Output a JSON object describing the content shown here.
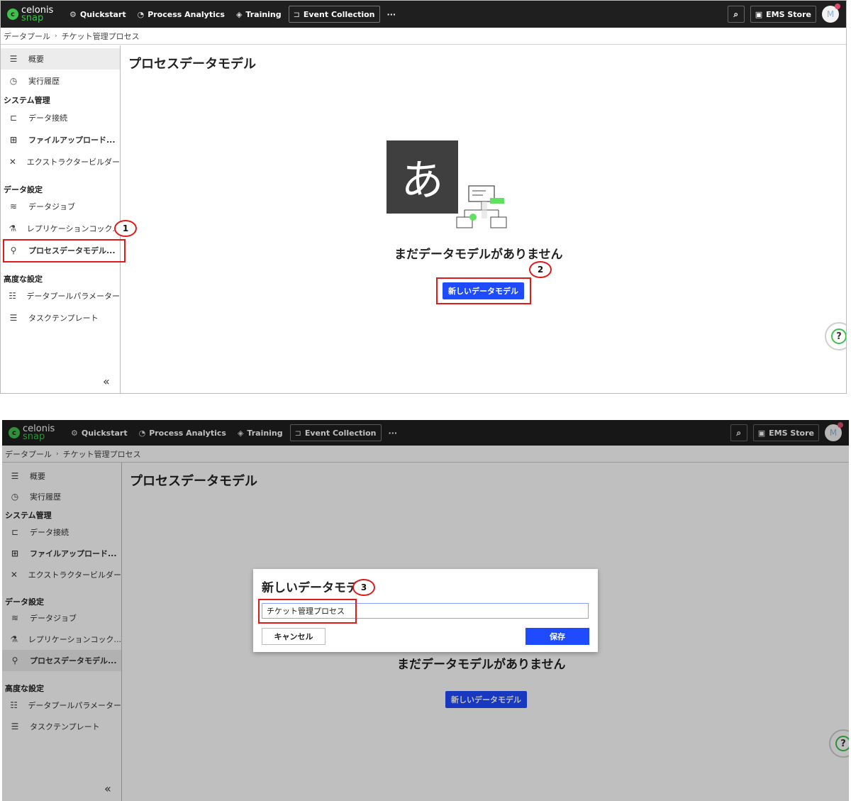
{
  "nav": {
    "logo_line1": "celonis",
    "logo_line2": "snap",
    "logo_mark": "c",
    "items": [
      {
        "label": "Quickstart",
        "icon": "quickstart-icon"
      },
      {
        "label": "Process Analytics",
        "icon": "process-analytics-icon"
      },
      {
        "label": "Training",
        "icon": "training-icon"
      },
      {
        "label": "Event Collection",
        "icon": "event-collection-icon"
      }
    ],
    "more": "···",
    "store_label": "EMS Store",
    "avatar_initial": "M"
  },
  "breadcrumb": {
    "root": "データプール",
    "current": "チケット管理プロセス"
  },
  "sidebar": {
    "overview": "概要",
    "history": "実行履歴",
    "section_system": "システム管理",
    "data_connection": "データ接続",
    "file_upload": "ファイルアップロード...",
    "extractor_builder": "エクストラクタービルダー",
    "section_data": "データ設定",
    "data_jobs": "データジョブ",
    "replication": "レプリケーションコック...",
    "process_data_model": "プロセスデータモデル...",
    "section_advanced": "高度な設定",
    "pool_params": "データプールパラメーター",
    "task_templates": "タスクテンプレート",
    "collapse": "«"
  },
  "main": {
    "title": "プロセスデータモデル",
    "illustration_glyph": "あ",
    "empty_title": "まだデータモデルがありません",
    "new_button": "新しいデータモデル",
    "help": "?"
  },
  "modal": {
    "title": "新しいデータモデル",
    "input_value": "チケット管理プロセス",
    "cancel": "キャンセル",
    "save": "保存"
  },
  "callouts": [
    "1",
    "2",
    "3"
  ],
  "colors": {
    "primary": "#1f4bff",
    "brand_green": "#3ec14b",
    "highlight_red": "#e01919",
    "topbar": "#1f1f1f"
  }
}
